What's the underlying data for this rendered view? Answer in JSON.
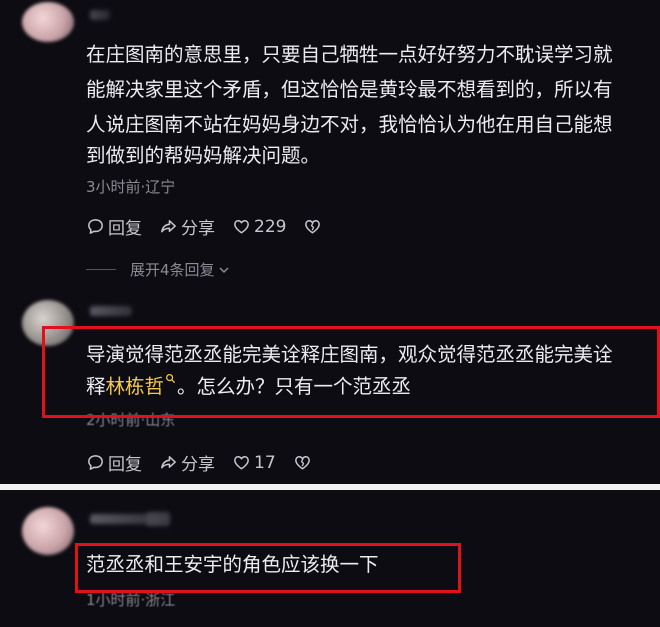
{
  "comments": [
    {
      "text_lines": [
        "在庄图南的意思里，只要自己牺牲一点好好努力不耽误学习就",
        "能解决家里这个矛盾，但这恰恰是黄玲最不想看到的，所以有",
        "人说庄图南不站在妈妈身边不对，我恰恰认为他在用自己能想",
        "到做到的帮妈妈解决问题。"
      ],
      "meta": "3小时前·辽宁",
      "reply_label": "回复",
      "share_label": "分享",
      "like_count": "229",
      "expand_label": "展开4条回复"
    },
    {
      "line1": "导演觉得范丞丞能完美诠释庄图南，观众觉得范丞丞能完美诠",
      "line2_prefix": "释",
      "mention": "林栋哲",
      "line2_suffix": "。怎么办？只有一个范丞丞",
      "meta": "2小时前·山东",
      "reply_label": "回复",
      "share_label": "分享",
      "like_count": "17"
    },
    {
      "text": "范丞丞和王安宇的角色应该换一下",
      "meta": "1小时前·浙江"
    }
  ],
  "colors": {
    "highlight_box": "#e2101d",
    "mention": "#f2c94c",
    "background": "#0d0c12"
  },
  "icons": [
    "chat-bubble-icon",
    "share-arrow-icon",
    "heart-icon",
    "broken-heart-icon",
    "chevron-down-icon",
    "search-icon"
  ]
}
